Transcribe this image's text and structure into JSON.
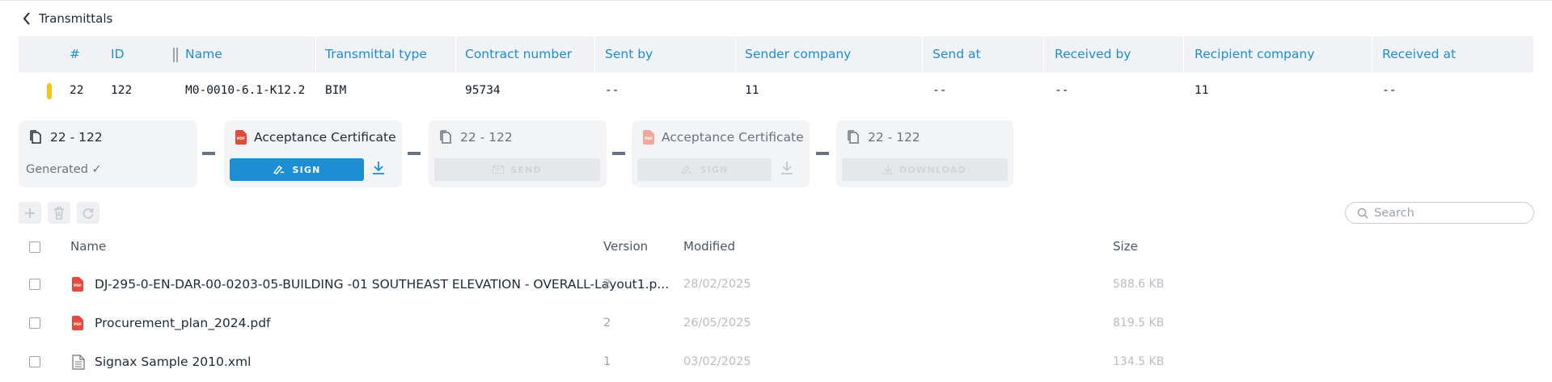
{
  "header": {
    "back_label": "Transmittals"
  },
  "table": {
    "columns": [
      "#",
      "ID",
      "Name",
      "Transmittal type",
      "Contract number",
      "Sent by",
      "Sender company",
      "Send at",
      "Received by",
      "Recipient company",
      "Received at"
    ],
    "rows": [
      {
        "num": "22",
        "id": "122",
        "name": "M0-0010-6.1-K12.2",
        "type": "BIM",
        "contract": "95734",
        "sent_by": "--",
        "sender_company": "11",
        "send_at": "--",
        "received_by": "--",
        "recipient_company": "11",
        "received_at": "--",
        "marker_color": "#f5c518"
      }
    ]
  },
  "workflow": {
    "steps": [
      {
        "title": "22 - 122",
        "status": "Generated ✓",
        "icon": "document-icon"
      },
      {
        "title": "Acceptance Certificate",
        "button": "SIGN",
        "icon": "pdf-icon"
      },
      {
        "title": "22 - 122",
        "button": "SEND",
        "icon": "document-icon"
      },
      {
        "title": "Acceptance Certificate",
        "button": "SIGN",
        "icon": "pdf-icon"
      },
      {
        "title": "22 - 122",
        "button": "DOWNLOAD",
        "icon": "document-icon"
      }
    ]
  },
  "toolbar": {
    "search_placeholder": "Search"
  },
  "files": {
    "headers": {
      "name": "Name",
      "version": "Version",
      "modified": "Modified",
      "size": "Size"
    },
    "rows": [
      {
        "name": "DJ-295-0-EN-DAR-00-0203-05-BUILDING -01 SOUTHEAST ELEVATION - OVERALL-Layout1.p...",
        "version": "2",
        "modified": "28/02/2025",
        "size": "588.6 KB",
        "icon": "pdf-icon"
      },
      {
        "name": "Procurement_plan_2024.pdf",
        "version": "2",
        "modified": "26/05/2025",
        "size": "819.5 KB",
        "icon": "pdf-icon"
      },
      {
        "name": "Signax Sample 2010.xml",
        "version": "1",
        "modified": "03/02/2025",
        "size": "134.5 KB",
        "icon": "file-icon"
      }
    ]
  },
  "colors": {
    "accent": "#1d8ed4",
    "pdf": "#e24b3b",
    "marker": "#f5c518"
  }
}
